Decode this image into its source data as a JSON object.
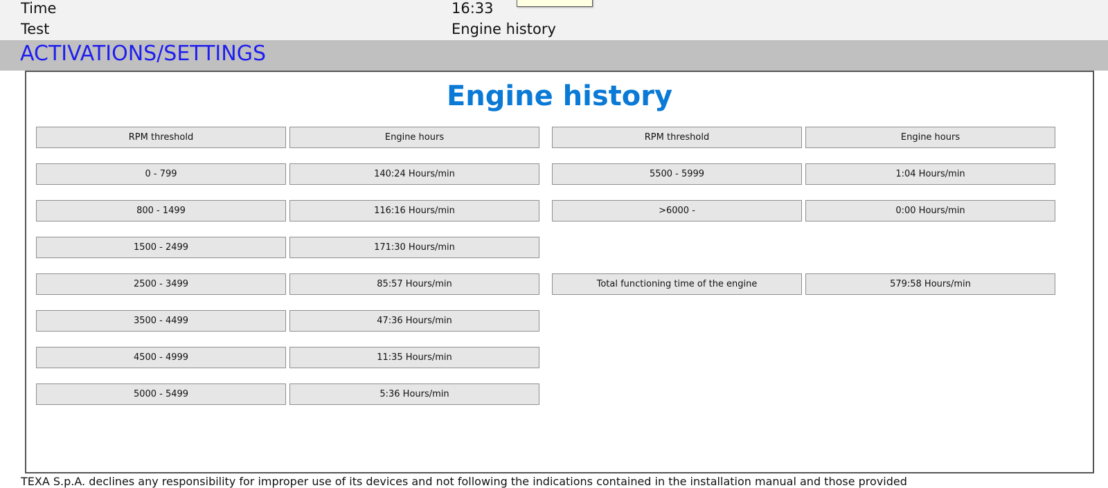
{
  "info": {
    "time_label": "Time",
    "time_value": "16:33",
    "test_label": "Test",
    "test_value": "Engine history"
  },
  "section": {
    "title": "ACTIVATIONS/SETTINGS"
  },
  "panel": {
    "title": "Engine history",
    "left_table": {
      "headers": [
        "RPM threshold",
        "Engine hours"
      ],
      "rows": [
        [
          "0 - 799",
          "140:24 Hours/min"
        ],
        [
          "800 - 1499",
          "116:16 Hours/min"
        ],
        [
          "1500 - 2499",
          "171:30 Hours/min"
        ],
        [
          "2500 - 3499",
          "85:57 Hours/min"
        ],
        [
          "3500 - 4499",
          "47:36 Hours/min"
        ],
        [
          "4500 - 4999",
          "11:35 Hours/min"
        ],
        [
          "5000 - 5499",
          "5:36 Hours/min"
        ]
      ]
    },
    "right_table": {
      "headers": [
        "RPM threshold",
        "Engine hours"
      ],
      "rows": [
        [
          "5500 - 5999",
          "1:04 Hours/min"
        ],
        [
          ">6000 -",
          "0:00 Hours/min"
        ]
      ]
    },
    "total": {
      "label": "Total functioning time of the engine",
      "value": "579:58 Hours/min"
    }
  },
  "footer": {
    "text": "TEXA S.p.A. declines any responsibility for improper use of its devices and not following the indications contained in the installation manual and those provided"
  }
}
